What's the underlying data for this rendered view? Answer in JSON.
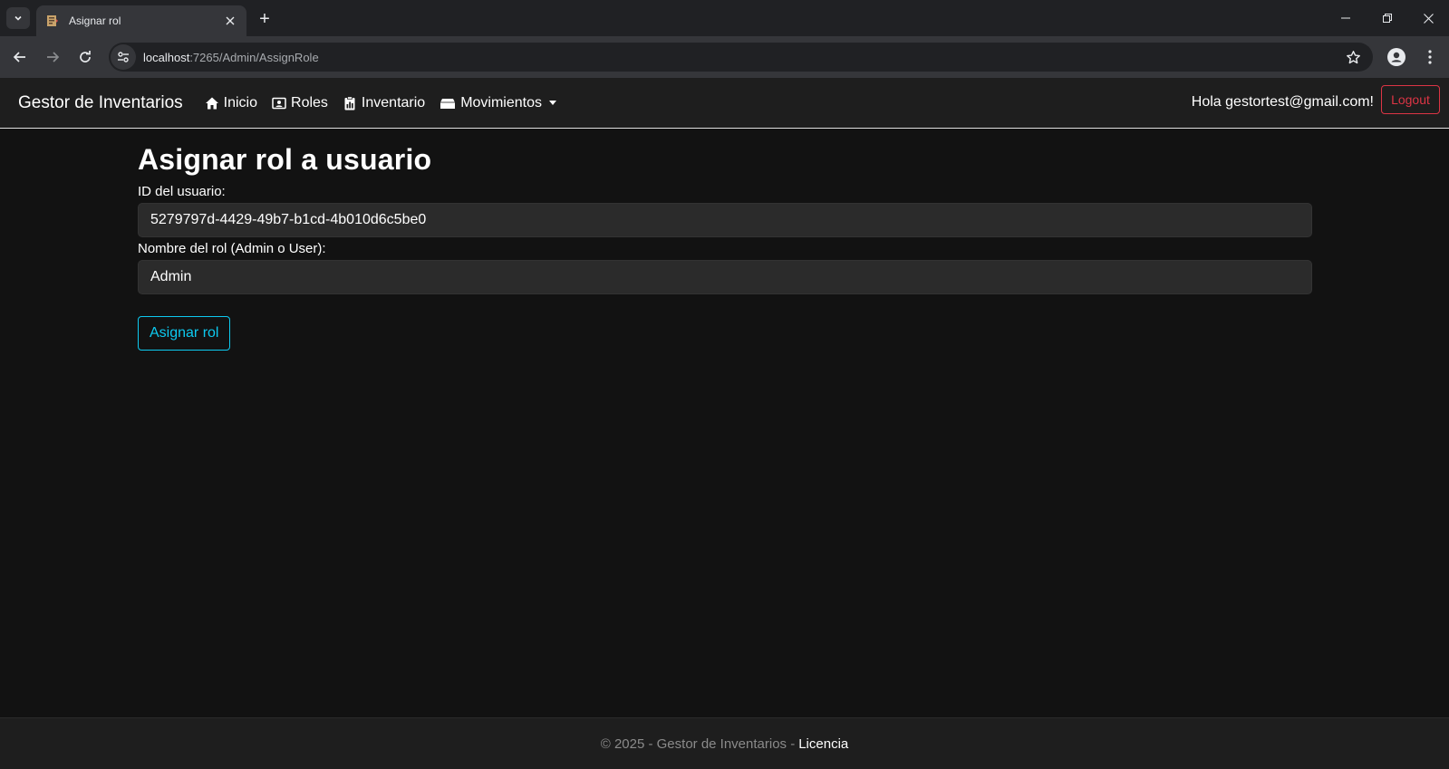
{
  "browser": {
    "tab_title": "Asignar rol",
    "new_tab_symbol": "+",
    "url_host": "localhost",
    "url_path": ":7265/Admin/AssignRole"
  },
  "navbar": {
    "brand": "Gestor de Inventarios",
    "links": [
      {
        "label": "Inicio",
        "icon": "home-icon"
      },
      {
        "label": "Roles",
        "icon": "id-card-icon"
      },
      {
        "label": "Inventario",
        "icon": "clipboard-chart-icon"
      },
      {
        "label": "Movimientos",
        "icon": "box-icon"
      }
    ],
    "greeting": "Hola gestortest@gmail.com!",
    "logout_label": "Logout"
  },
  "main": {
    "title": "Asignar rol a usuario",
    "user_id_label": "ID del usuario:",
    "user_id_value": "5279797d-4429-49b7-b1cd-4b010d6c5be0",
    "role_label": "Nombre del rol (Admin o User):",
    "role_value": "Admin",
    "submit_label": "Asignar rol"
  },
  "footer": {
    "text": "© 2025 - Gestor de Inventarios -",
    "link": "Licencia"
  },
  "colors": {
    "accent_info": "#0dcaf0",
    "danger": "#dc3545",
    "page_bg": "#121212"
  }
}
